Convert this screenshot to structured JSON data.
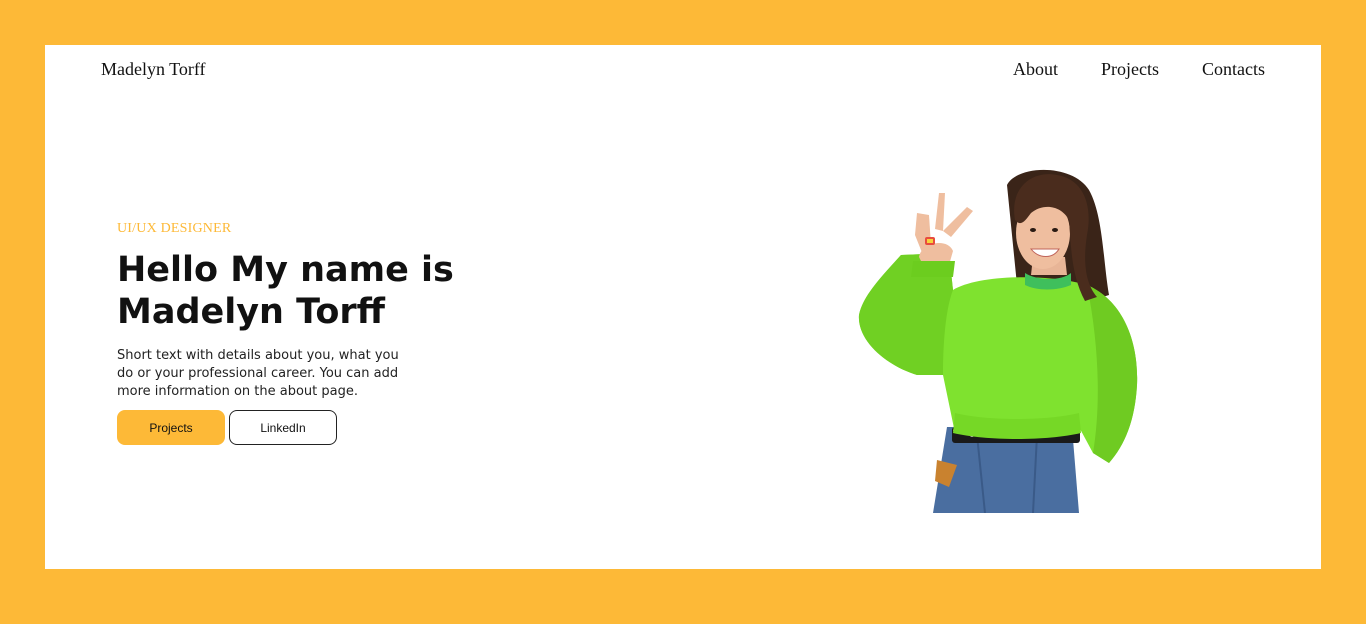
{
  "header": {
    "brand": "Madelyn Torff",
    "nav": [
      {
        "label": "About"
      },
      {
        "label": "Projects"
      },
      {
        "label": "Contacts"
      }
    ]
  },
  "hero": {
    "role": "UI/UX DESIGNER",
    "title_line1": "Hello My name is",
    "title_line2": "Madelyn Torff",
    "description": "Short text with details about you, what you do or your professional career. You can add more information on the about page.",
    "buttons": {
      "primary_label": "Projects",
      "secondary_label": "LinkedIn"
    }
  },
  "colors": {
    "accent": "#FDB937",
    "background": "#FFFFFF",
    "text": "#111111"
  }
}
